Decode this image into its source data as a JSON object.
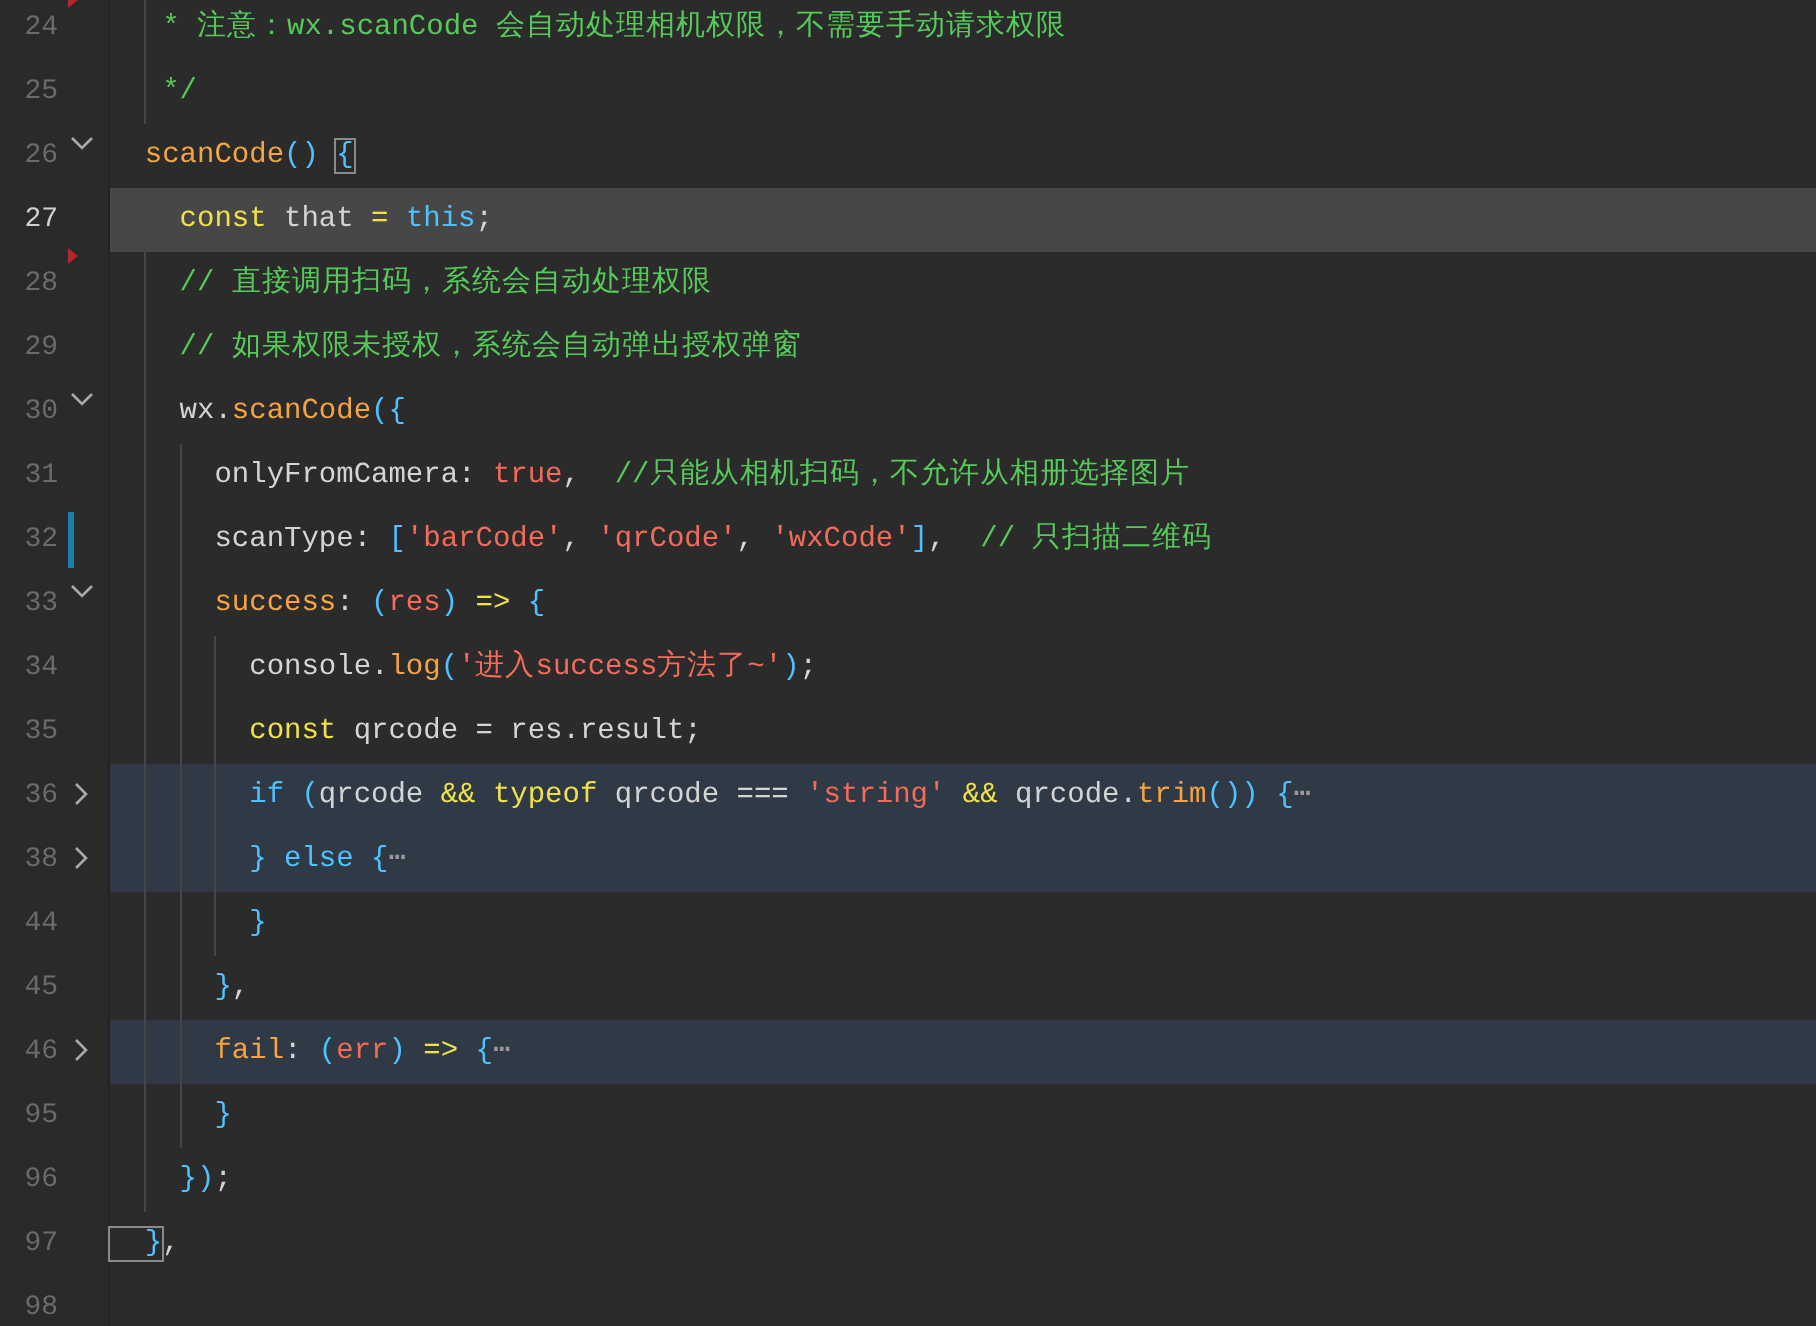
{
  "editor": {
    "lines": [
      {
        "number": "24",
        "current": false,
        "folded": false,
        "deleted_above": true,
        "tokens": [
          {
            "kind": "comment",
            "t": "   * 注意：wx.scanCode 会自动处理相机权限，不需要手动请求权限"
          }
        ]
      },
      {
        "number": "25",
        "current": false,
        "folded": false,
        "tokens": [
          {
            "kind": "comment",
            "t": "   */"
          }
        ]
      },
      {
        "number": "26",
        "current": false,
        "folded": false,
        "collapsed": false,
        "tokens": [
          {
            "kind": "fn",
            "t": "  scanCode"
          },
          {
            "kind": "brace",
            "t": "() "
          },
          {
            "kind": "brace",
            "t": "{",
            "matched": true
          }
        ]
      },
      {
        "number": "27",
        "current": true,
        "folded": false,
        "tokens": [
          {
            "kind": "kw",
            "t": "    const"
          },
          {
            "kind": "plain",
            "t": " that "
          },
          {
            "kind": "kw",
            "t": "= "
          },
          {
            "kind": "blue",
            "t": "this"
          },
          {
            "kind": "plain",
            "t": ";"
          }
        ]
      },
      {
        "number": "28",
        "current": false,
        "folded": false,
        "deleted_above": true,
        "tokens": [
          {
            "kind": "comment",
            "t": "    // 直接调用扫码，系统会自动处理权限"
          }
        ]
      },
      {
        "number": "29",
        "current": false,
        "folded": false,
        "tokens": [
          {
            "kind": "comment",
            "t": "    // 如果权限未授权，系统会自动弹出授权弹窗"
          }
        ]
      },
      {
        "number": "30",
        "current": false,
        "folded": false,
        "collapsed": false,
        "tokens": [
          {
            "kind": "plain",
            "t": "    wx."
          },
          {
            "kind": "fn",
            "t": "scanCode"
          },
          {
            "kind": "brace",
            "t": "({"
          }
        ]
      },
      {
        "number": "31",
        "current": false,
        "folded": false,
        "tokens": [
          {
            "kind": "plain",
            "t": "      onlyFromCamera: "
          },
          {
            "kind": "str",
            "t": "true"
          },
          {
            "kind": "plain",
            "t": ",  "
          },
          {
            "kind": "comment",
            "t": "//只能从相机扫码，不允许从相册选择图片"
          }
        ]
      },
      {
        "number": "32",
        "current": false,
        "folded": false,
        "modified": true,
        "tokens": [
          {
            "kind": "plain",
            "t": "      scanType: "
          },
          {
            "kind": "brace",
            "t": "["
          },
          {
            "kind": "str",
            "t": "'barCode'"
          },
          {
            "kind": "plain",
            "t": ", "
          },
          {
            "kind": "str",
            "t": "'qrCode'"
          },
          {
            "kind": "plain",
            "t": ", "
          },
          {
            "kind": "str",
            "t": "'wxCode'"
          },
          {
            "kind": "brace",
            "t": "]"
          },
          {
            "kind": "plain",
            "t": ",  "
          },
          {
            "kind": "comment",
            "t": "// 只扫描二维码"
          }
        ]
      },
      {
        "number": "33",
        "current": false,
        "folded": false,
        "collapsed": false,
        "tokens": [
          {
            "kind": "fn",
            "t": "      success"
          },
          {
            "kind": "plain",
            "t": ": "
          },
          {
            "kind": "brace",
            "t": "("
          },
          {
            "kind": "str",
            "t": "res"
          },
          {
            "kind": "brace",
            "t": ") "
          },
          {
            "kind": "kw",
            "t": "=> "
          },
          {
            "kind": "brace",
            "t": "{"
          }
        ]
      },
      {
        "number": "34",
        "current": false,
        "folded": false,
        "tokens": [
          {
            "kind": "plain",
            "t": "        console."
          },
          {
            "kind": "fn",
            "t": "log"
          },
          {
            "kind": "brace",
            "t": "("
          },
          {
            "kind": "str",
            "t": "'进入success方法了~'"
          },
          {
            "kind": "brace",
            "t": ")"
          },
          {
            "kind": "plain",
            "t": ";"
          }
        ]
      },
      {
        "number": "35",
        "current": false,
        "folded": false,
        "tokens": [
          {
            "kind": "kw",
            "t": "        const"
          },
          {
            "kind": "plain",
            "t": " qrcode = res.result;"
          }
        ]
      },
      {
        "number": "36",
        "current": false,
        "folded": true,
        "collapsed": true,
        "tokens": [
          {
            "kind": "blue",
            "t": "        if "
          },
          {
            "kind": "brace",
            "t": "("
          },
          {
            "kind": "plain",
            "t": "qrcode "
          },
          {
            "kind": "kw",
            "t": "&& typeof"
          },
          {
            "kind": "plain",
            "t": " qrcode === "
          },
          {
            "kind": "str",
            "t": "'string' "
          },
          {
            "kind": "kw",
            "t": "&&"
          },
          {
            "kind": "plain",
            "t": " qrcode."
          },
          {
            "kind": "fn",
            "t": "trim"
          },
          {
            "kind": "brace",
            "t": "()) {"
          },
          {
            "kind": "dim",
            "t": "⋯"
          }
        ]
      },
      {
        "number": "38",
        "current": false,
        "folded": true,
        "collapsed": true,
        "tokens": [
          {
            "kind": "brace",
            "t": "        } "
          },
          {
            "kind": "blue",
            "t": "else {"
          },
          {
            "kind": "dim",
            "t": "⋯"
          }
        ]
      },
      {
        "number": "44",
        "current": false,
        "folded": false,
        "tokens": [
          {
            "kind": "brace",
            "t": "        }"
          }
        ]
      },
      {
        "number": "45",
        "current": false,
        "folded": false,
        "tokens": [
          {
            "kind": "brace",
            "t": "      }"
          },
          {
            "kind": "plain",
            "t": ","
          }
        ]
      },
      {
        "number": "46",
        "current": false,
        "folded": true,
        "collapsed": true,
        "tokens": [
          {
            "kind": "fn",
            "t": "      fail"
          },
          {
            "kind": "plain",
            "t": ": "
          },
          {
            "kind": "brace",
            "t": "("
          },
          {
            "kind": "str",
            "t": "err"
          },
          {
            "kind": "brace",
            "t": ") "
          },
          {
            "kind": "kw",
            "t": "=> "
          },
          {
            "kind": "brace",
            "t": "{"
          },
          {
            "kind": "dim",
            "t": "⋯"
          }
        ]
      },
      {
        "number": "95",
        "current": false,
        "folded": false,
        "tokens": [
          {
            "kind": "brace",
            "t": "      }"
          }
        ]
      },
      {
        "number": "96",
        "current": false,
        "folded": false,
        "tokens": [
          {
            "kind": "brace",
            "t": "    })"
          },
          {
            "kind": "plain",
            "t": ";"
          }
        ]
      },
      {
        "number": "97",
        "current": false,
        "folded": false,
        "tokens": [
          {
            "kind": "brace",
            "t": "  }",
            "matched": true
          },
          {
            "kind": "plain",
            "t": ","
          }
        ]
      },
      {
        "number": "98",
        "current": false,
        "folded": false
      }
    ]
  }
}
